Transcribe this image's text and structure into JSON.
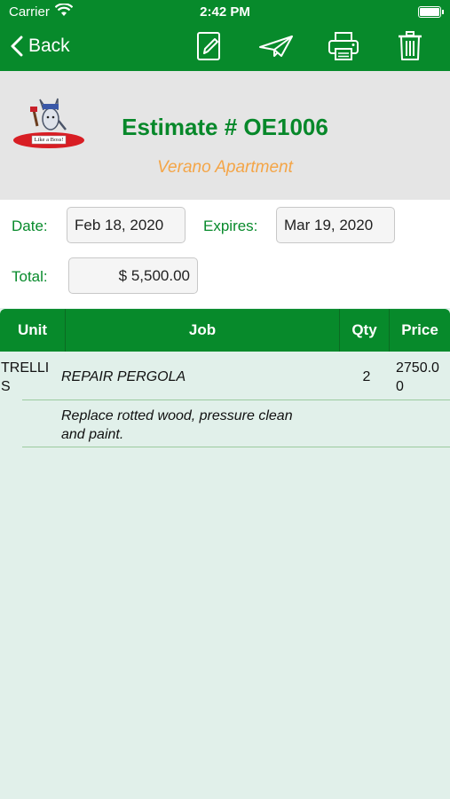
{
  "status_bar": {
    "carrier": "Carrier",
    "time": "2:42 PM"
  },
  "nav": {
    "back_label": "Back",
    "icons": [
      "edit-icon",
      "send-icon",
      "print-icon",
      "trash-icon"
    ]
  },
  "header": {
    "logo_text": "Like a Boss!",
    "title": "Estimate # OE1006",
    "subtitle": "Verano Apartment"
  },
  "form": {
    "date_label": "Date:",
    "date_value": "Feb 18, 2020",
    "expires_label": "Expires:",
    "expires_value": "Mar 19, 2020",
    "total_label": "Total:",
    "total_value": "$ 5,500.00"
  },
  "table": {
    "headers": {
      "unit": "Unit",
      "job": "Job",
      "qty": "Qty",
      "price": "Price"
    },
    "rows": [
      {
        "unit_line1": "TRELLI",
        "unit_line2": "S",
        "job": "REPAIR PERGOLA",
        "qty": "2",
        "price_line1": "2750.0",
        "price_line2": "0",
        "description_line1": "Replace rotted wood, pressure clean",
        "description_line2": "and paint."
      }
    ]
  },
  "colors": {
    "primary_green": "#078a2b",
    "title_green": "#07882a",
    "subtitle_orange": "#f4a547",
    "header_gray": "#e5e5e5",
    "list_background": "#e1f0ea"
  }
}
